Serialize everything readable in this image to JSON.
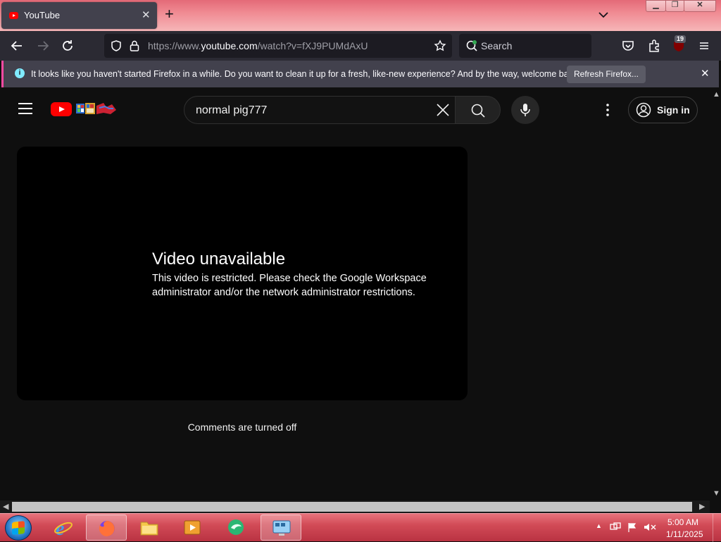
{
  "browser": {
    "tab_title": "YouTube",
    "tab_close": "✕",
    "new_tab": "+",
    "url_prefix": "https://www.",
    "url_domain": "youtube.com",
    "url_path": "/watch?v=fXJ9PUMdAxU",
    "search_placeholder": "Search",
    "extension_badge": "19"
  },
  "notification": {
    "text": "It looks like you haven't started Firefox in a while. Do you want to clean it up for a fresh, like-new experience? And by the way, welcome back!",
    "button_label": "Refresh Firefox...",
    "close": "✕",
    "info": "i"
  },
  "youtube": {
    "search_query": "normal pig777",
    "sign_in_label": "Sign in",
    "error_title": "Video unavailable",
    "error_message": "This video is restricted. Please check the Google Workspace administrator and/or the network administrator restrictions.",
    "comments_status": "Comments are turned off"
  },
  "taskbar": {
    "time": "5:00 AM",
    "date": "1/11/2025",
    "apps": [
      "internet-explorer",
      "firefox",
      "file-explorer",
      "media-player",
      "messenger",
      "remote-desktop"
    ],
    "active_app": "firefox"
  },
  "colors": {
    "accent_red": "#ff0000",
    "page_bg": "#0f0f0f",
    "browser_chrome": "#2b2a33",
    "notification_accent": "#ff4aa2"
  }
}
